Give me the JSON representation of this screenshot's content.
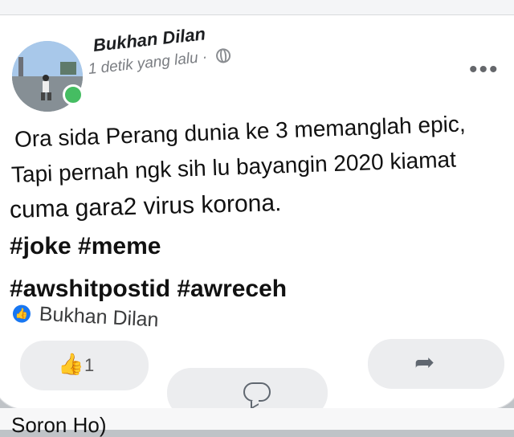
{
  "post": {
    "author": "Bukhan Dilan",
    "timestamp": "1 detik yang lalu",
    "separator": "·",
    "privacy_icon": "globe-icon",
    "more_label": "•••",
    "lines": [
      "Ora sida Perang dunia ke 3  memanglah epic,",
      "Tapi pernah ngk sih lu bayangin 2020 kiamat",
      "cuma gara2 virus korona."
    ],
    "hashtags_line1": "#joke #meme",
    "hashtags_line2": "#awshitpostid #awreceh",
    "shared_from": "Bukhan Dilan",
    "like_count": "1"
  },
  "next_post": {
    "peek_text": "Soron Ho)"
  },
  "colors": {
    "accent": "#1877f2",
    "online": "#45bd62",
    "button_bg": "#ecedef"
  }
}
